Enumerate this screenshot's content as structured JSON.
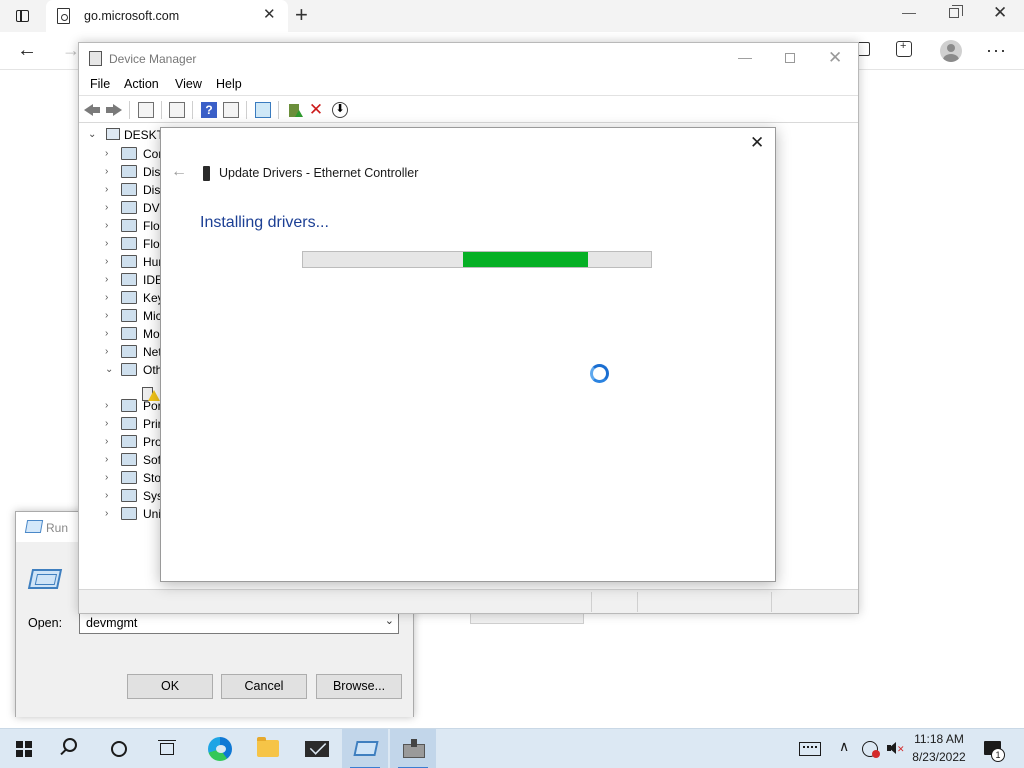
{
  "browser": {
    "tab_title": "go.microsoft.com",
    "tab_close": "✕",
    "new_tab": "+",
    "back": "←",
    "forward": "→",
    "more": "···",
    "window_minimize": "—",
    "window_close": "✕"
  },
  "run_dialog": {
    "title": "Run",
    "open_label": "Open:",
    "open_value": "devmgmt",
    "dropdown_arrow": "⌄",
    "ok_label": "OK",
    "cancel_label": "Cancel",
    "browse_label": "Browse..."
  },
  "device_manager": {
    "title": "Device Manager",
    "minimize": "—",
    "close": "✕",
    "menu": [
      "File",
      "Action",
      "View",
      "Help"
    ],
    "toolbar": {
      "help": "?",
      "remove": "✕",
      "download": "⬇"
    },
    "tree_root": "DESKTC",
    "tree_items": [
      {
        "label": "Cor",
        "expanded": false
      },
      {
        "label": "Disk",
        "expanded": false
      },
      {
        "label": "Disp",
        "expanded": false
      },
      {
        "label": "DVD",
        "expanded": false
      },
      {
        "label": "Flop",
        "expanded": false
      },
      {
        "label": "Flop",
        "expanded": false
      },
      {
        "label": "Hun",
        "expanded": false
      },
      {
        "label": "IDE",
        "expanded": false
      },
      {
        "label": "Key",
        "expanded": false
      },
      {
        "label": "Mic",
        "expanded": false
      },
      {
        "label": "Mo",
        "expanded": false
      },
      {
        "label": "Net",
        "expanded": false
      },
      {
        "label": "Oth",
        "expanded": true
      },
      {
        "label": "Por",
        "expanded": false
      },
      {
        "label": "Prir",
        "expanded": false
      },
      {
        "label": "Pro",
        "expanded": false
      },
      {
        "label": "Sof",
        "expanded": false
      },
      {
        "label": "Sto",
        "expanded": false
      },
      {
        "label": "Syst",
        "expanded": false
      },
      {
        "label": "Uni",
        "expanded": false
      }
    ],
    "chevron_collapsed": "›",
    "chevron_expanded": "⌄"
  },
  "update_wizard": {
    "close": "✕",
    "back": "←",
    "title": "Update Drivers - Ethernet Controller",
    "heading": "Installing drivers...",
    "progress_indeterminate_start": 0.46,
    "progress_indeterminate_end": 0.82,
    "progress_color": "#06b025"
  },
  "taskbar": {
    "time": "11:18 AM",
    "date": "8/23/2022",
    "volume_muted_mark": "✕",
    "show_hidden": "∧",
    "notification_count": "1",
    "pinned_apps": [
      "edge-icon",
      "file-explorer-icon",
      "mail-icon",
      "run-icon",
      "device-manager-icon"
    ]
  },
  "colors": {
    "taskbar_bg": "#dce8f3",
    "wizard_heading": "#1c3f94",
    "accent": "#1a6ed1"
  }
}
